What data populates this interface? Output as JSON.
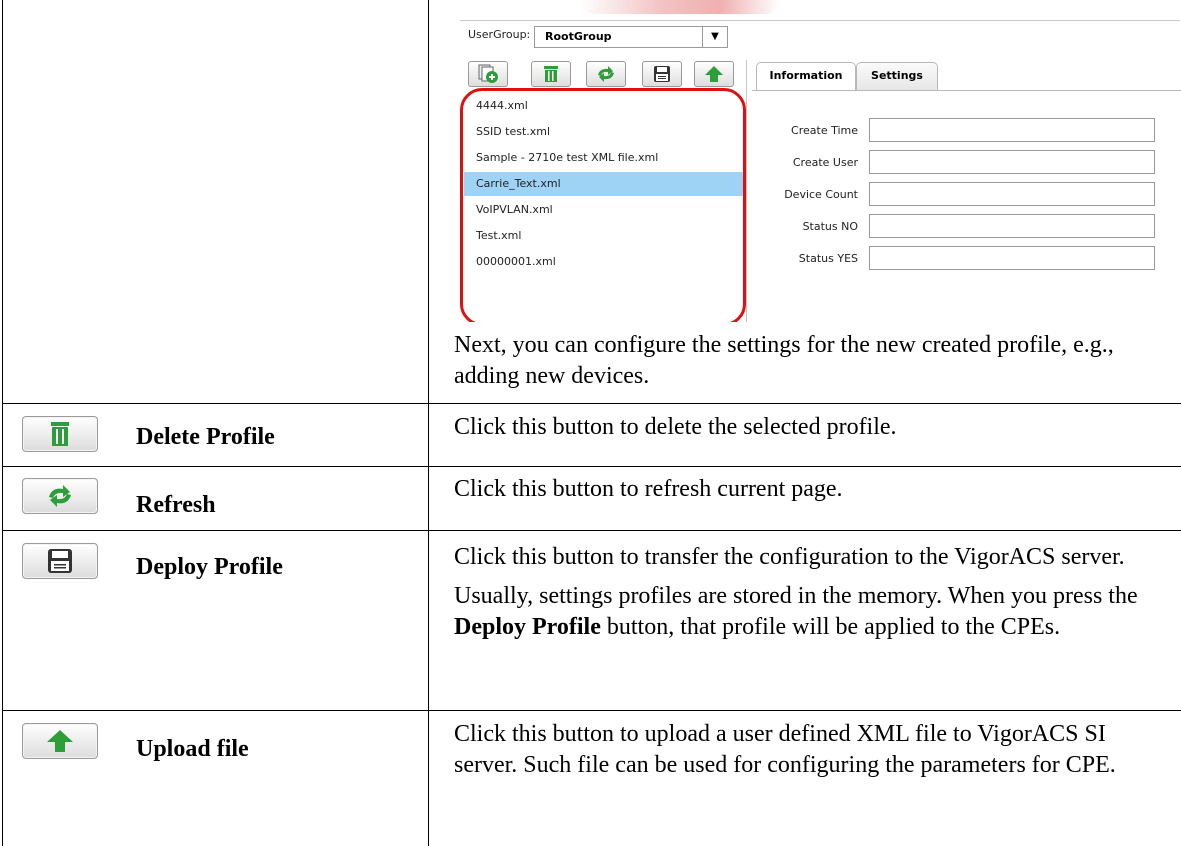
{
  "screenshot": {
    "usergroup_label": "UserGroup:",
    "usergroup_value": "RootGroup",
    "toolbar_icons": [
      "add-profile-icon",
      "trash-icon",
      "refresh-icon",
      "save-disk-icon",
      "upload-arrow-icon"
    ],
    "files": [
      "4444.xml",
      "SSID test.xml",
      "Sample - 2710e test XML file.xml",
      "Carrie_Text.xml",
      "VoIPVLAN.xml",
      "Test.xml",
      "00000001.xml"
    ],
    "selected_file": "Carrie_Text.xml",
    "tabs": [
      "Information",
      "Settings"
    ],
    "fields": [
      "Create Time",
      "Create User",
      "Device Count",
      "Status NO",
      "Status YES"
    ]
  },
  "rows": [
    {
      "label": "",
      "paragraphs": [
        "Next, you can configure the settings for the new created profile, e.g., adding new devices."
      ]
    },
    {
      "label": "Delete Profile",
      "icon": "trash-icon",
      "paragraphs": [
        "Click this button to delete the selected profile."
      ]
    },
    {
      "label": "Refresh",
      "icon": "refresh-icon",
      "paragraphs": [
        "Click this button to refresh current page."
      ]
    },
    {
      "label": "Deploy Profile",
      "icon": "save-disk-icon",
      "paragraphs": [
        "Click this button to transfer the configuration to the VigorACS server."
      ],
      "para2_a": "Usually, settings profiles are stored in the memory. When you press the ",
      "para2_b": "Deploy Profile",
      "para2_c": " button, that profile will be applied to the CPEs."
    },
    {
      "label": "Upload file",
      "icon": "upload-arrow-icon",
      "paragraphs": [
        "Click this button to upload a user defined XML file to VigorACS SI server. Such file can be used for configuring the parameters for CPE."
      ]
    }
  ],
  "colors": {
    "selected": "#9fd3f5",
    "highlight_ring": "#e01010",
    "icon_green": "#2e9e3a"
  }
}
